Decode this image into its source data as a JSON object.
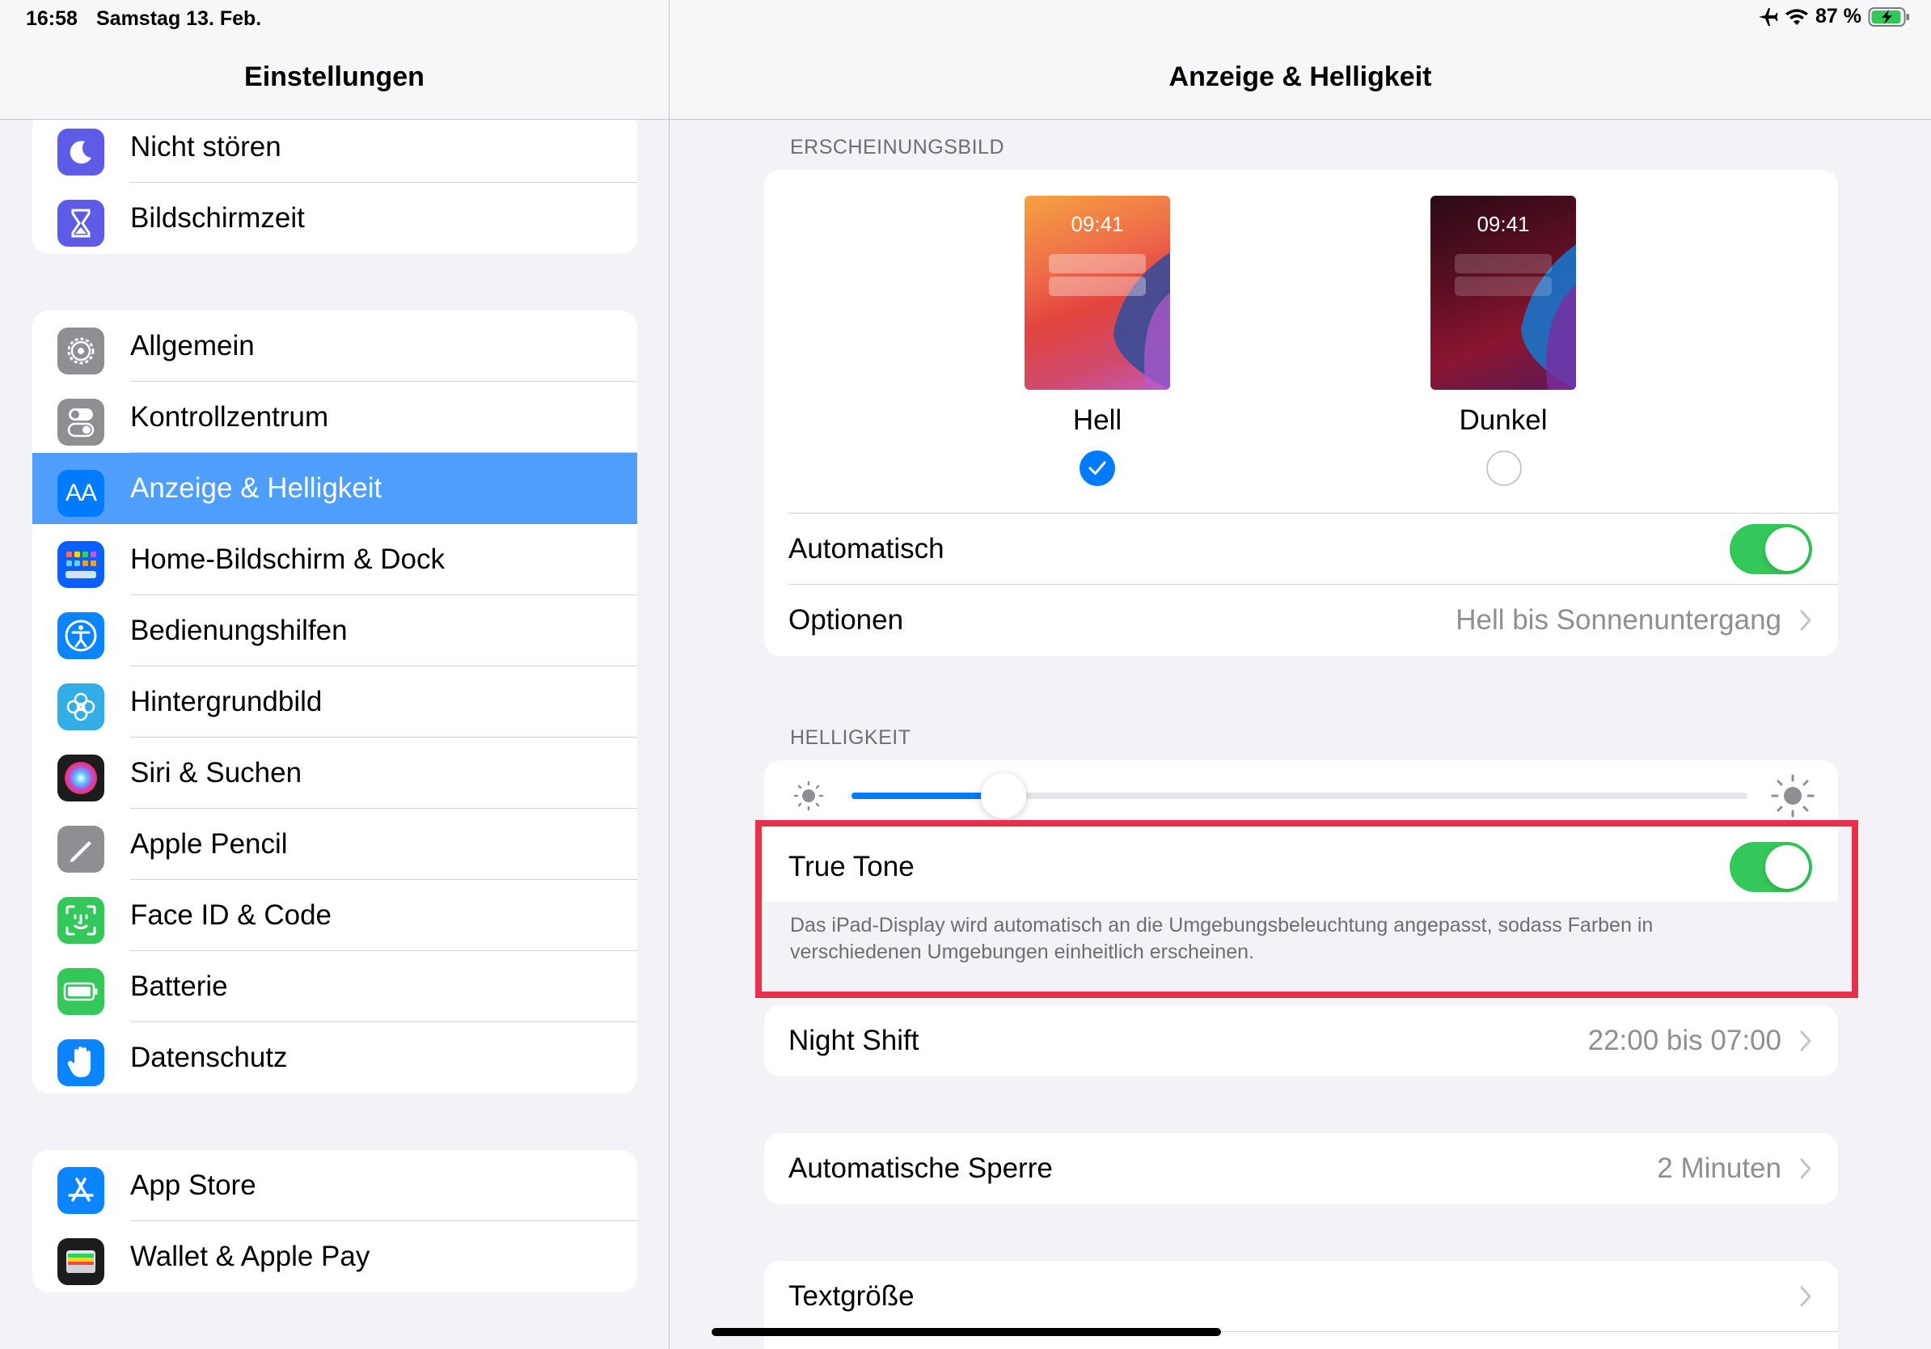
{
  "status_bar": {
    "time": "16:58",
    "date": "Samstag 13. Feb.",
    "battery": "87 %"
  },
  "sidebar": {
    "title": "Einstellungen",
    "groups": [
      {
        "items": [
          {
            "label": "Nicht stören",
            "icon": "moon-icon",
            "color": "#5e5ce6"
          },
          {
            "label": "Bildschirmzeit",
            "icon": "hourglass-icon",
            "color": "#5e5ce6"
          }
        ]
      },
      {
        "items": [
          {
            "label": "Allgemein",
            "icon": "gear-icon",
            "color": "#8e8e93"
          },
          {
            "label": "Kontrollzentrum",
            "icon": "toggles-icon",
            "color": "#8e8e93"
          },
          {
            "label": "Anzeige & Helligkeit",
            "icon": "text-size-icon",
            "color": "#007aff",
            "selected": true
          },
          {
            "label": "Home-Bildschirm & Dock",
            "icon": "app-grid-icon",
            "color": "#0a60ff"
          },
          {
            "label": "Bedienungshilfen",
            "icon": "accessibility-icon",
            "color": "#0a84ff"
          },
          {
            "label": "Hintergrundbild",
            "icon": "flower-icon",
            "color": "#32ade6"
          },
          {
            "label": "Siri & Suchen",
            "icon": "siri-icon",
            "color": "#1c1c1e"
          },
          {
            "label": "Apple Pencil",
            "icon": "pencil-icon",
            "color": "#8e8e93"
          },
          {
            "label": "Face ID & Code",
            "icon": "face-id-icon",
            "color": "#34c759"
          },
          {
            "label": "Batterie",
            "icon": "battery-icon",
            "color": "#34c759"
          },
          {
            "label": "Datenschutz",
            "icon": "hand-icon",
            "color": "#0a84ff"
          }
        ]
      },
      {
        "items": [
          {
            "label": "App Store",
            "icon": "app-store-icon",
            "color": "#0a84ff"
          },
          {
            "label": "Wallet & Apple Pay",
            "icon": "wallet-icon",
            "color": "#1c1c1e"
          }
        ]
      }
    ]
  },
  "main": {
    "title": "Anzeige & Helligkeit",
    "appearance": {
      "section_label": "ERSCHEINUNGSBILD",
      "light": {
        "label": "Hell",
        "time": "09:41",
        "selected": true
      },
      "dark": {
        "label": "Dunkel",
        "time": "09:41",
        "selected": false
      },
      "automatic": {
        "label": "Automatisch",
        "on": true
      },
      "options": {
        "label": "Optionen",
        "value": "Hell bis Sonnenuntergang"
      }
    },
    "brightness": {
      "section_label": "HELLIGKEIT",
      "level": 0.17,
      "true_tone": {
        "label": "True Tone",
        "on": true
      },
      "true_tone_desc_line1": "Das iPad-Display wird automatisch an die Umgebungsbeleuchtung angepasst, sodass Farben in",
      "true_tone_desc_line2": "verschiedenen Umgebungen einheitlich erscheinen."
    },
    "night_shift": {
      "label": "Night Shift",
      "value": "22:00 bis 07:00"
    },
    "auto_lock": {
      "label": "Automatische Sperre",
      "value": "2 Minuten"
    },
    "text_size": {
      "label": "Textgröße"
    }
  },
  "colors": {
    "accent": "#007aff",
    "toggle_on": "#34c759",
    "selected_row": "#4f9efc",
    "highlight_frame": "#e8304a"
  }
}
